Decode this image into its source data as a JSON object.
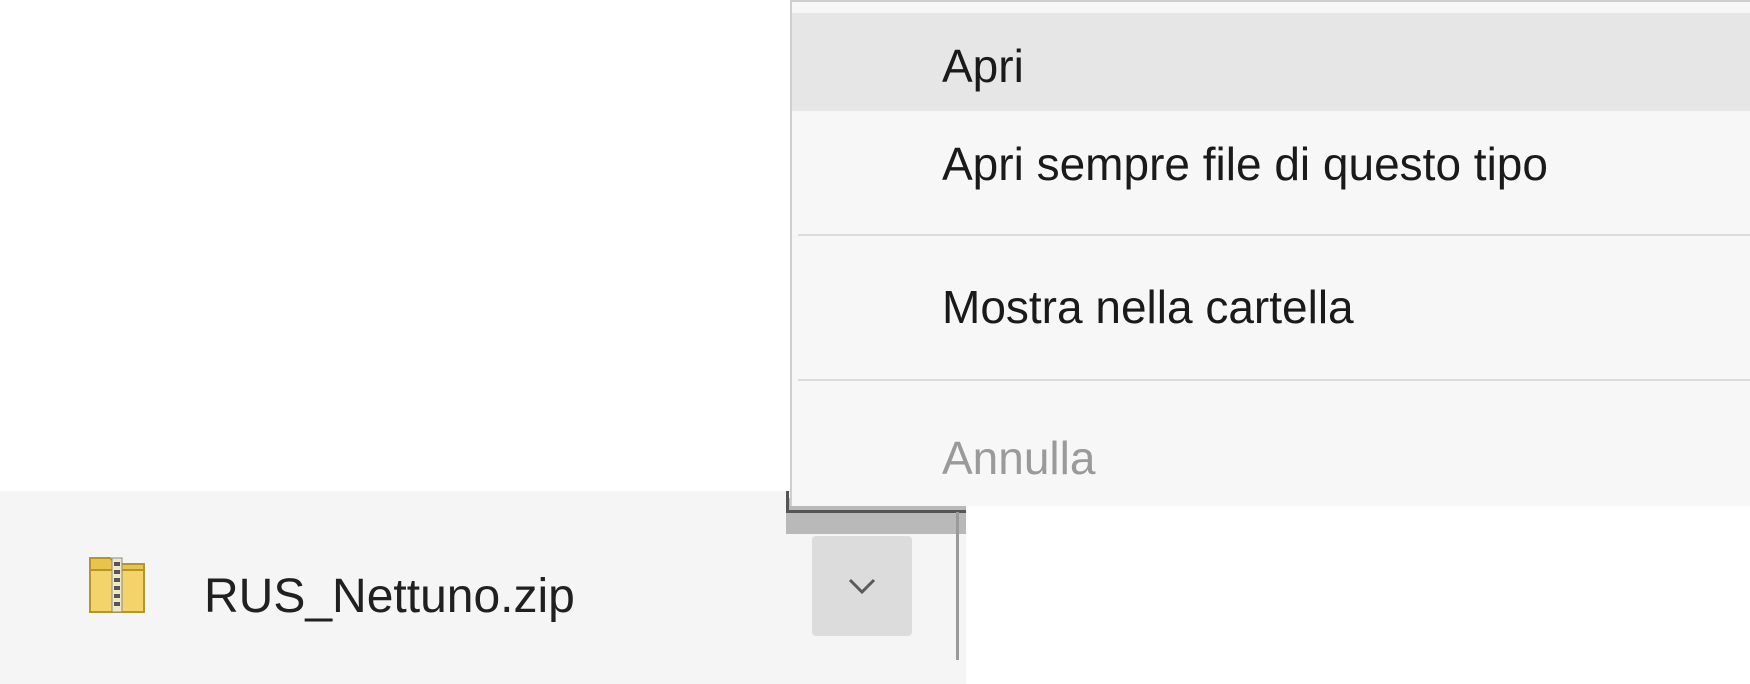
{
  "download_shelf": {
    "file_name": "RUS_Nettuno.zip",
    "file_icon": "zip-folder-icon",
    "options_icon": "chevron-down-icon"
  },
  "context_menu": {
    "items": [
      {
        "label": "Apri",
        "state": "highlighted"
      },
      {
        "label": "Apri sempre file di questo tipo",
        "state": "normal"
      },
      {
        "label": "Mostra nella cartella",
        "state": "normal"
      },
      {
        "label": "Annulla",
        "state": "disabled"
      }
    ]
  },
  "colors": {
    "highlight": "#e6e6e6",
    "disabled_text": "#9a9a9a",
    "menu_background": "#f7f7f7",
    "shelf_background": "#f5f5f5",
    "button_background": "#dcdcdc"
  }
}
